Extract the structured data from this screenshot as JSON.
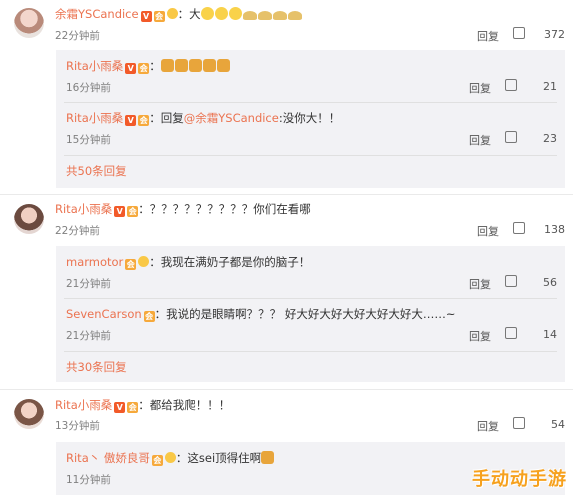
{
  "comments": [
    {
      "user": "余霜YSCandice",
      "text": "：大",
      "time": "22分钟前",
      "reply": "回复",
      "likes": "372",
      "replies": [
        {
          "user": "Rita小雨桑",
          "text": "：",
          "time": "16分钟前",
          "reply": "回复",
          "likes": "21"
        },
        {
          "user": "Rita小雨桑",
          "text": "：回复",
          "mention": "@余霜YSCandice",
          "tail": ":没你大！！",
          "time": "15分钟前",
          "reply": "回复",
          "likes": "23"
        }
      ],
      "more": "共50条回复"
    },
    {
      "user": "Rita小雨桑",
      "text": "：？？？？？？？？？你们在看哪",
      "time": "22分钟前",
      "reply": "回复",
      "likes": "138",
      "replies": [
        {
          "user": "marmotor",
          "text": "：我现在满奶子都是你的脑子！",
          "time": "21分钟前",
          "reply": "回复",
          "likes": "56"
        },
        {
          "user": "SevenCarson",
          "text": "：我说的是眼睛啊？？？ 好大好大好大好大好大好大……~",
          "time": "21分钟前",
          "reply": "回复",
          "likes": "14"
        }
      ],
      "more": "共30条回复"
    },
    {
      "user": "Rita小雨桑",
      "text": "：都给我爬！！！",
      "time": "13分钟前",
      "reply": "回复",
      "likes": "54",
      "replies": [
        {
          "user": "Rita丶 傲娇良哥",
          "text": "：这sei顶得住啊",
          "time": "11分钟前"
        }
      ]
    }
  ],
  "watermark": "手动动手游"
}
